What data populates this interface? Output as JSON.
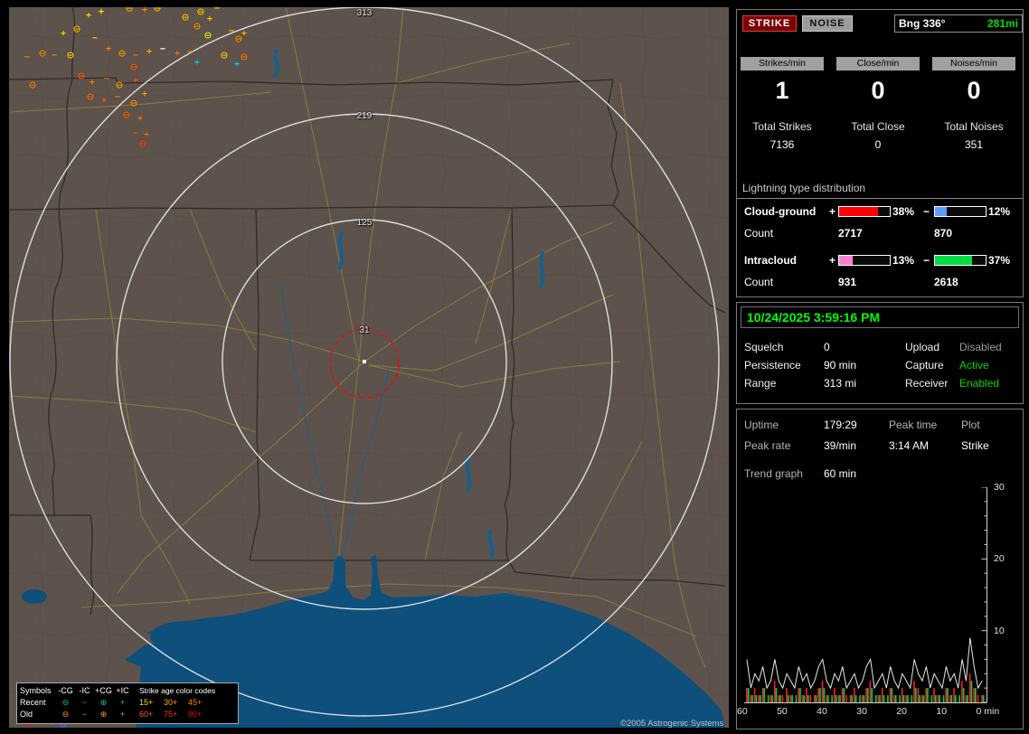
{
  "map": {
    "ring_labels": [
      {
        "text": "313"
      },
      {
        "text": "219"
      },
      {
        "text": "125"
      },
      {
        "text": "31"
      }
    ],
    "copyright": "©2005 Astrogenic Systems",
    "legend": {
      "col_headers": [
        "Symbols",
        "-CG",
        "-IC",
        "+CG",
        "+IC"
      ],
      "age_header": "Strike age color codes",
      "symbols": [
        "⊖",
        "−",
        "⊕",
        "+"
      ],
      "rows": [
        {
          "label": "Recent",
          "sym_color": "#00c8a8",
          "ages": [
            {
              "t": "15+",
              "c": "#ffe000"
            },
            {
              "t": "30+",
              "c": "#ffaa00"
            },
            {
              "t": "45+",
              "c": "#ff8000"
            }
          ]
        },
        {
          "label": "Old",
          "sym_color": "#ff9600",
          "ages": [
            {
              "t": "60+",
              "c": "#ff6400"
            },
            {
              "t": "75+",
              "c": "#ff3200"
            },
            {
              "t": "90+",
              "c": "#ff0000"
            }
          ]
        }
      ]
    },
    "strikes": [
      [
        50,
        54,
        "−",
        "#ff8a00"
      ],
      [
        37,
        52,
        "⊖",
        "#ff8a00"
      ],
      [
        68,
        54,
        "⊖",
        "#ffd000"
      ],
      [
        88,
        10,
        "+",
        "#ffd000"
      ],
      [
        102,
        6,
        "+",
        "#ffe000"
      ],
      [
        133,
        2,
        "⊖",
        "#ffb000"
      ],
      [
        150,
        4,
        "+",
        "#ff9000"
      ],
      [
        164,
        2,
        "⊖",
        "#ffc000"
      ],
      [
        212,
        6,
        "⊖",
        "#ffd000"
      ],
      [
        222,
        14,
        "+",
        "#ffc000"
      ],
      [
        208,
        22,
        "⊖",
        "#ff9000"
      ],
      [
        220,
        32,
        "⊖",
        "#ffe000"
      ],
      [
        246,
        27,
        "−",
        "#ffd000"
      ],
      [
        254,
        36,
        "⊖",
        "#ff9000"
      ],
      [
        260,
        30,
        "+",
        "#ffb000"
      ],
      [
        110,
        47,
        "+",
        "#ff8000"
      ],
      [
        125,
        52,
        "⊖",
        "#ffa000"
      ],
      [
        140,
        54,
        "−",
        "#ff8000"
      ],
      [
        155,
        50,
        "+",
        "#ffb000"
      ],
      [
        170,
        47,
        "−",
        "#ffffff"
      ],
      [
        186,
        52,
        "+",
        "#ff7000"
      ],
      [
        200,
        50,
        "−",
        "#ff9000"
      ],
      [
        208,
        62,
        "+",
        "#00d8d8"
      ],
      [
        252,
        64,
        "+",
        "#00d8d8"
      ],
      [
        238,
        54,
        "⊖",
        "#ffd000"
      ],
      [
        260,
        56,
        "⊖",
        "#ff8000"
      ],
      [
        80,
        77,
        "⊖",
        "#ff6000"
      ],
      [
        92,
        84,
        "+",
        "#ff8000"
      ],
      [
        108,
        80,
        "−",
        "#ff7000"
      ],
      [
        122,
        87,
        "⊖",
        "#ffa000"
      ],
      [
        140,
        82,
        "+",
        "#ff5000"
      ],
      [
        90,
        100,
        "⊖",
        "#ff7000"
      ],
      [
        105,
        104,
        "+",
        "#ff6000"
      ],
      [
        120,
        100,
        "−",
        "#ff8000"
      ],
      [
        138,
        107,
        "⊖",
        "#ff9000"
      ],
      [
        150,
        97,
        "+",
        "#ffa000"
      ],
      [
        130,
        120,
        "⊖",
        "#ff6000"
      ],
      [
        145,
        124,
        "+",
        "#ff7000"
      ],
      [
        140,
        140,
        "−",
        "#ff5000"
      ],
      [
        152,
        142,
        "+",
        "#ff6000"
      ],
      [
        148,
        152,
        "⊖",
        "#ff4800"
      ],
      [
        26,
        87,
        "⊖",
        "#ff8000"
      ],
      [
        20,
        56,
        "−",
        "#ff9000"
      ],
      [
        230,
        2,
        "−",
        "#ffd000"
      ],
      [
        195,
        12,
        "⊖",
        "#ffc000"
      ],
      [
        138,
        67,
        "⊖",
        "#ff6000"
      ],
      [
        60,
        30,
        "+",
        "#ffc800"
      ],
      [
        75,
        25,
        "⊖",
        "#ffb000"
      ],
      [
        95,
        35,
        "−",
        "#ffc800"
      ],
      [
        14,
        793,
        "−",
        "#ff3000"
      ],
      [
        24,
        793,
        "⊕",
        "#ff3000"
      ],
      [
        48,
        794,
        "−",
        "#4488ff"
      ],
      [
        60,
        794,
        "⊖",
        "#4488ff"
      ]
    ]
  },
  "panel": {
    "strike_button": "STRIKE",
    "noise_button": "NOISE",
    "bearing": {
      "label": "Bng 336°",
      "distance": "281mi"
    },
    "rates": [
      {
        "label": "Strikes/min",
        "value": "1",
        "total_label": "Total Strikes",
        "total": "7136"
      },
      {
        "label": "Close/min",
        "value": "0",
        "total_label": "Total Close",
        "total": "0"
      },
      {
        "label": "Noises/min",
        "value": "0",
        "total_label": "Total Noises",
        "total": "351"
      }
    ],
    "distribution": {
      "title": "Lightning type distribution",
      "plus_sign": "+",
      "minus_sign": "−",
      "rows": [
        {
          "label": "Cloud-ground",
          "plus_pct": 38,
          "plus_pct_text": "38%",
          "plus_color": "#ff0000",
          "minus_pct": 12,
          "minus_pct_text": "12%",
          "minus_color": "#5c9dff",
          "count_label": "Count",
          "plus_count": "2717",
          "minus_count": "870"
        },
        {
          "label": "Intracloud",
          "plus_pct": 13,
          "plus_pct_text": "13%",
          "plus_color": "#ff80d2",
          "minus_pct": 37,
          "minus_pct_text": "37%",
          "minus_color": "#00dd44",
          "count_label": "Count",
          "plus_count": "931",
          "minus_count": "2618"
        }
      ]
    },
    "status": {
      "datetime": "10/24/2025 3:59:16 PM",
      "rows": [
        {
          "k1": "Squelch",
          "v1": "0",
          "k2": "Upload",
          "v2": "Disabled"
        },
        {
          "k1": "Persistence",
          "v1": "90 min",
          "k2": "Capture",
          "v2": "Active"
        },
        {
          "k1": "Range",
          "v1": "313 mi",
          "k2": "Receiver",
          "v2": "Enabled"
        }
      ]
    },
    "stats": {
      "uptime_label": "Uptime",
      "uptime": "179:29",
      "peak_time_label": "Peak time",
      "plot_label": "Plot",
      "peak_rate_label": "Peak rate",
      "peak_rate": "39/min",
      "peak_time": "3:14 AM",
      "plot_value": "Strike",
      "trend_label": "Trend graph",
      "trend_value": "60 min"
    }
  },
  "chart_data": {
    "type": "bar",
    "title": "Trend graph (strikes per minute, last 60 min)",
    "x_ticks": [
      "60",
      "50",
      "40",
      "30",
      "20",
      "10",
      "0 min"
    ],
    "y_ticks": [
      "30",
      "20",
      "10"
    ],
    "ylim": [
      0,
      30
    ],
    "series": [
      {
        "name": "total",
        "color": "#e8e8e8",
        "values": [
          6,
          2,
          4,
          3,
          5,
          2,
          3,
          6,
          3,
          2,
          4,
          3,
          2,
          5,
          3,
          4,
          2,
          3,
          5,
          6,
          3,
          2,
          4,
          3,
          5,
          2,
          3,
          4,
          2,
          3,
          5,
          6,
          2,
          3,
          4,
          2,
          5,
          3,
          2,
          4,
          3,
          2,
          6,
          4,
          3,
          5,
          2,
          4,
          3,
          2,
          5,
          3,
          4,
          2,
          6,
          3,
          9,
          5,
          2,
          3
        ]
      },
      {
        "name": "cloud-ground",
        "color": "#ff2020",
        "values": [
          2,
          1,
          2,
          1,
          2,
          0,
          1,
          3,
          1,
          1,
          2,
          1,
          0,
          2,
          1,
          2,
          1,
          1,
          2,
          3,
          1,
          0,
          2,
          1,
          2,
          1,
          1,
          2,
          0,
          1,
          2,
          3,
          0,
          1,
          2,
          0,
          2,
          1,
          0,
          2,
          1,
          0,
          3,
          2,
          1,
          2,
          0,
          2,
          1,
          0,
          2,
          1,
          2,
          0,
          3,
          1,
          4,
          2,
          1,
          1
        ]
      },
      {
        "name": "intracloud",
        "color": "#00d050",
        "values": [
          2,
          1,
          1,
          1,
          2,
          1,
          1,
          2,
          1,
          0,
          1,
          1,
          1,
          2,
          1,
          1,
          0,
          1,
          2,
          2,
          1,
          1,
          1,
          1,
          2,
          0,
          1,
          1,
          1,
          1,
          2,
          2,
          1,
          1,
          1,
          1,
          2,
          1,
          1,
          1,
          1,
          1,
          2,
          1,
          1,
          2,
          1,
          1,
          1,
          1,
          2,
          1,
          1,
          1,
          2,
          1,
          3,
          2,
          0,
          1
        ]
      }
    ]
  }
}
